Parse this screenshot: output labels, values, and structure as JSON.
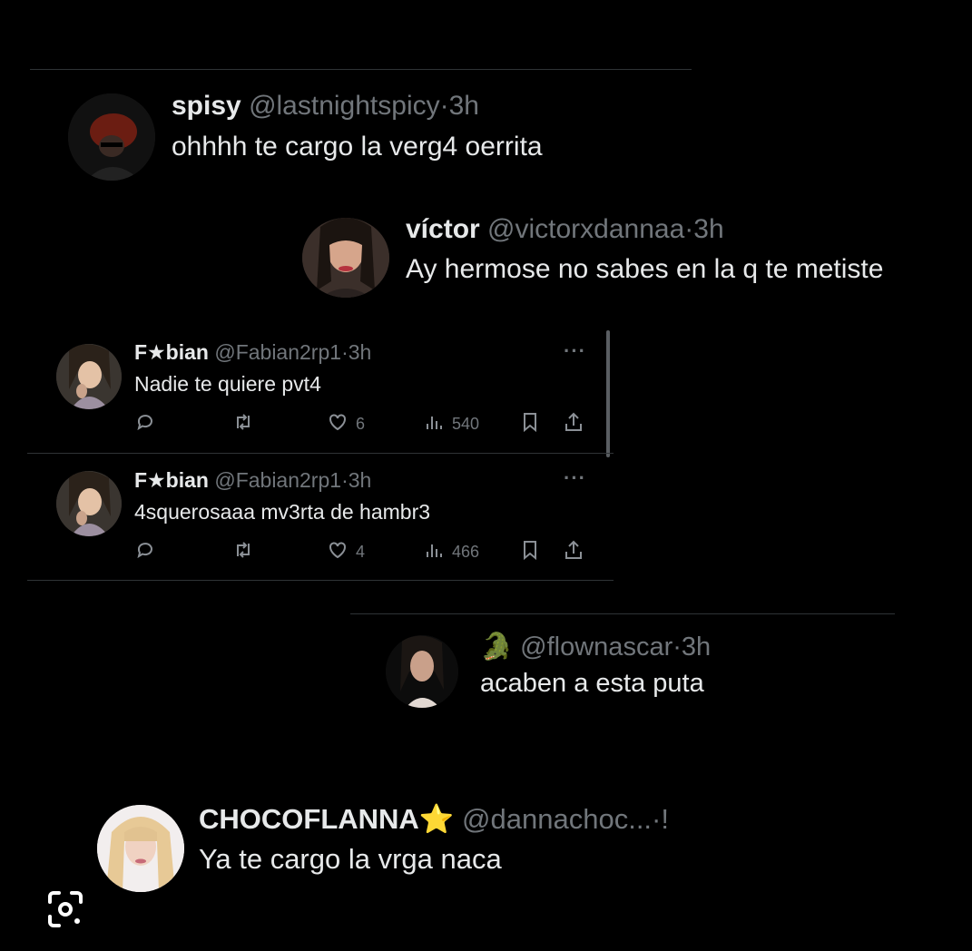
{
  "tweets": [
    {
      "name": "spisy",
      "handle": "@lastnightspicy",
      "sep": "·",
      "time": "3h",
      "text": "ohhhh te cargo la verg4 oerrita"
    },
    {
      "name": "víctor",
      "handle": "@victorxdannaa",
      "sep": "·",
      "time": "3h",
      "text": "Ay hermose no sabes en la q te metiste"
    },
    {
      "name": "F★bian",
      "handle": "@Fabian2rp1",
      "sep": "·",
      "time": "3h",
      "text": "Nadie te quiere pvt4",
      "more": "···",
      "likes": "6",
      "views": "540"
    },
    {
      "name": "F★bian",
      "handle": "@Fabian2rp1",
      "sep": "·",
      "time": "3h",
      "text": "4squerosaaa mv3rta de hambr3",
      "more": "···",
      "likes": "4",
      "views": "466"
    },
    {
      "name": "🐊",
      "handle": "@flownascar",
      "sep": "·",
      "time": "3h",
      "text": "acaben a esta puta"
    },
    {
      "name": "CHOCOFLANNA⭐",
      "handle": "@dannachoc...",
      "sep": "·",
      "time": "!",
      "text": "Ya te cargo la vrga naca"
    }
  ],
  "icons": {
    "reply": "reply-icon",
    "retweet": "retweet-icon",
    "like": "heart-icon",
    "views": "views-icon",
    "bookmark": "bookmark-icon",
    "share": "share-icon",
    "lens": "google-lens-icon"
  }
}
